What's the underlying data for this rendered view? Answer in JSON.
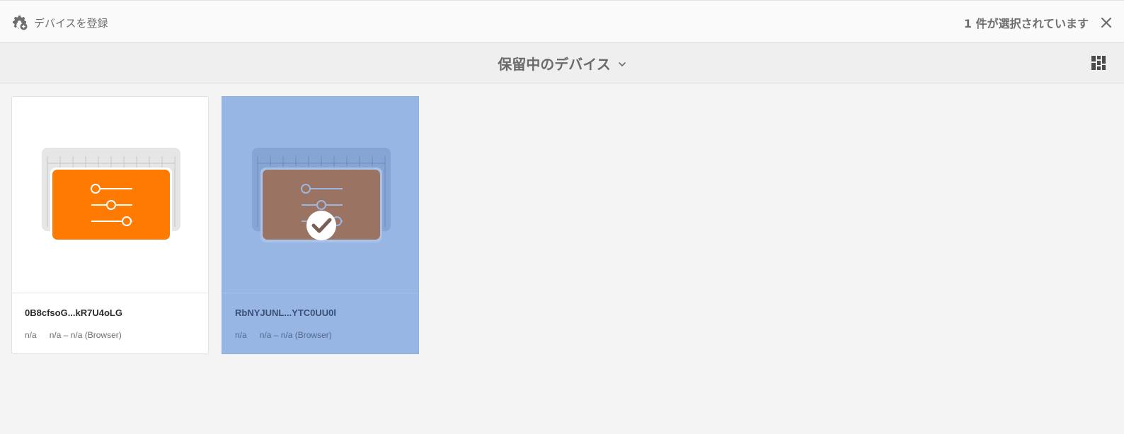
{
  "actionbar": {
    "register_label": "デバイスを登録",
    "register_icon": "gear-add-icon",
    "selection_count": "1 件が選択されています",
    "close_icon": "close-icon"
  },
  "titlebar": {
    "title": "保留中のデバイス",
    "dropdown_icon": "chevron-down-icon",
    "view_icon": "card-view-icon"
  },
  "devices": [
    {
      "name": "0B8cfsoG...kR7U4oLG",
      "status": "n/a",
      "detail": "n/a – n/a (Browser)",
      "selected": false,
      "thumb_color": "#ff7a00"
    },
    {
      "name": "RbNYJUNL...YTC0UU0l",
      "status": "n/a",
      "detail": "n/a – n/a (Browser)",
      "selected": true,
      "thumb_color": "#9a7363"
    }
  ],
  "colors": {
    "accent_orange": "#ff7a00",
    "selected_bg": "#97b6e4"
  }
}
